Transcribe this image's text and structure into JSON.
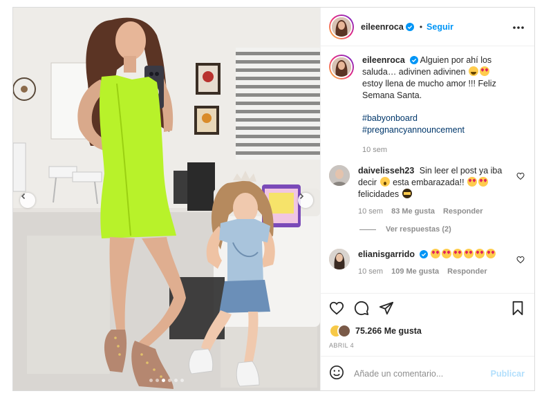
{
  "post": {
    "author": {
      "username": "eileenroca",
      "verified": true
    },
    "follow_label": "Seguir",
    "more_label": "•••",
    "caption": {
      "text": "Alguien por ahí los saluda… adivinen adivinen",
      "text2": "estoy llena de mucho amor !!! Feliz Semana Santa.",
      "hashtags": [
        "#babyonboard",
        "#pregnancyannouncement"
      ],
      "time": "10 sem"
    },
    "comments": [
      {
        "username": "daivelisseh23",
        "text": "Sin leer el post ya iba decir",
        "text2": "esta embarazada!!",
        "text3": "felicidades",
        "time": "10 sem",
        "likes": "83 Me gusta",
        "reply_label": "Responder",
        "view_replies": "Ver respuestas (2)"
      },
      {
        "username": "elianisgarrido",
        "verified": true,
        "time": "10 sem",
        "likes": "109 Me gusta",
        "reply_label": "Responder"
      }
    ],
    "likes_count": "75.266 Me gusta",
    "date": "ABRIL 4",
    "carousel": {
      "total": 6,
      "active": 3
    }
  },
  "composer": {
    "placeholder": "Añade un comentario...",
    "publish_label": "Publicar"
  },
  "icons": {
    "more": "more-horizontal-icon",
    "like": "heart-icon",
    "comment": "comment-bubble-icon",
    "share": "paper-plane-icon",
    "save": "bookmark-icon",
    "emoji": "smiley-icon",
    "verified": "verified-badge-icon"
  },
  "colors": {
    "link": "#0095f6",
    "hashtag": "#00376b",
    "muted": "#8e8e8e",
    "dress": "#b8f22a"
  }
}
